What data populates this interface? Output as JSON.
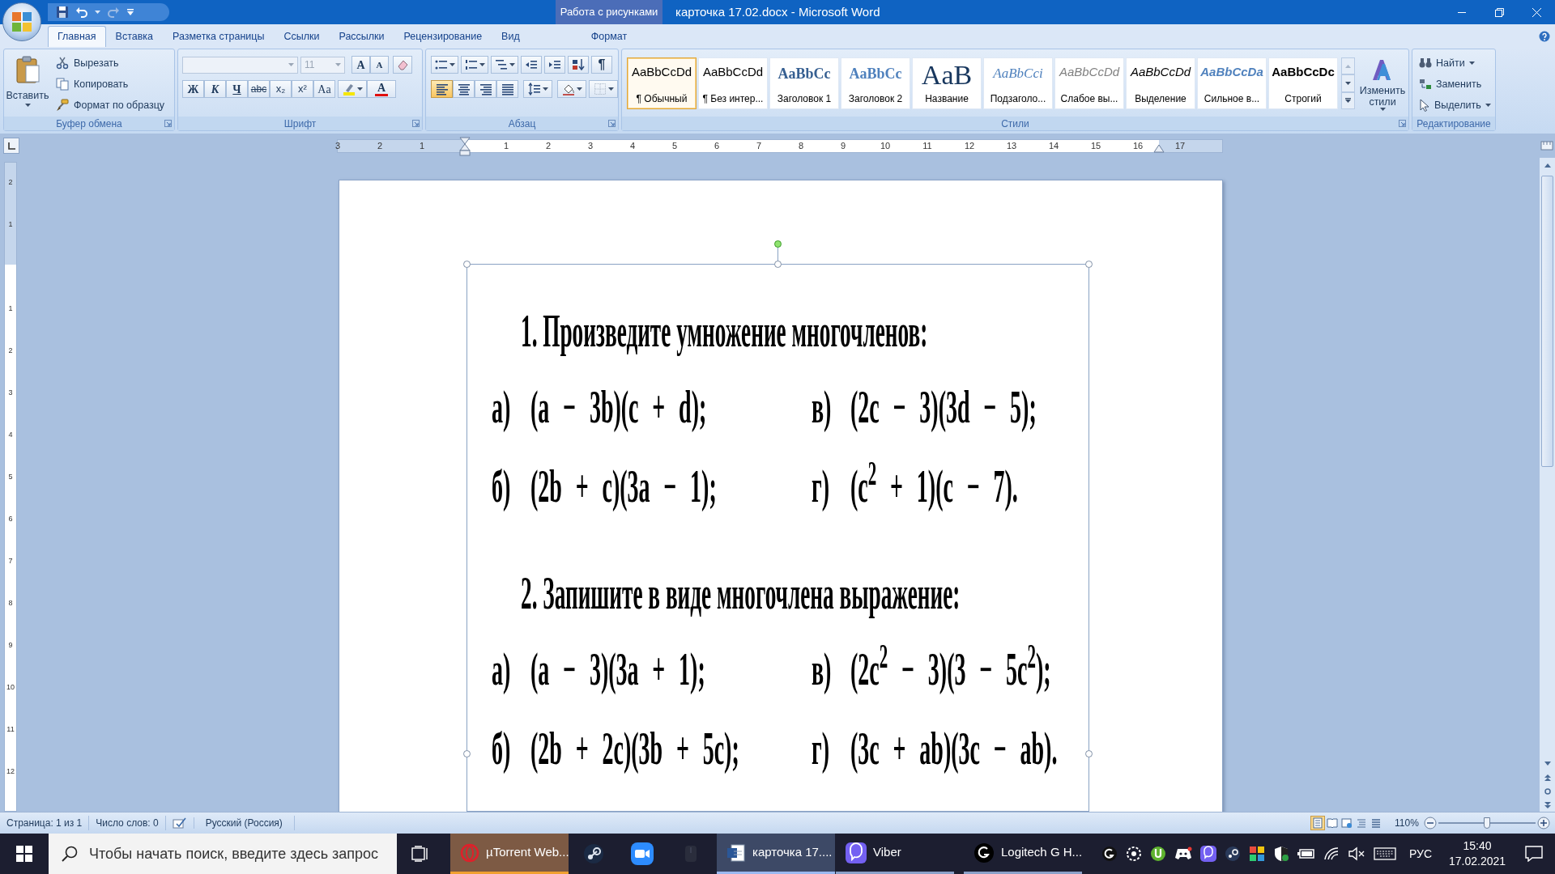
{
  "window": {
    "title": "карточка 17.02.docx - Microsoft Word",
    "contextual_group": "Работа с рисунками"
  },
  "tabs": [
    {
      "label": "Главная",
      "selected": true
    },
    {
      "label": "Вставка",
      "selected": false
    },
    {
      "label": "Разметка страницы",
      "selected": false
    },
    {
      "label": "Ссылки",
      "selected": false
    },
    {
      "label": "Рассылки",
      "selected": false
    },
    {
      "label": "Рецензирование",
      "selected": false
    },
    {
      "label": "Вид",
      "selected": false
    }
  ],
  "contextual_tabs": [
    {
      "label": "Формат",
      "selected": false
    }
  ],
  "clipboard": {
    "label": "Буфер обмена",
    "paste": "Вставить",
    "commands": [
      "Вырезать",
      "Копировать",
      "Формат по образцу"
    ]
  },
  "font": {
    "label": "Шрифт",
    "disabled": true,
    "size": "11",
    "grow_shrink": [
      "A",
      "A"
    ],
    "format_buttons": [
      "Ж",
      "К",
      "Ч",
      "abc",
      "x₂",
      "x²",
      "Aa"
    ],
    "font_color": "A"
  },
  "paragraph": {
    "label": "Абзац",
    "marks_button": "¶",
    "alignment": [
      {
        "selected": true
      },
      {
        "selected": false
      },
      {
        "selected": false
      },
      {
        "selected": false
      }
    ]
  },
  "styles": {
    "label": "Стили",
    "change_styles": "Изменить стили",
    "items": [
      {
        "kind": "normal",
        "sample": "AaBbCcDd",
        "label": "¶ Обычный",
        "selected": true
      },
      {
        "kind": "normal",
        "sample": "AaBbCcDd",
        "label": "¶ Без интер...",
        "selected": false
      },
      {
        "kind": "heading1",
        "sample": "AaBbCc",
        "label": "Заголовок 1",
        "selected": false
      },
      {
        "kind": "heading2",
        "sample": "AaBbCc",
        "label": "Заголовок 2",
        "selected": false
      },
      {
        "kind": "title",
        "sample": "AaB",
        "label": "Название",
        "selected": false
      },
      {
        "kind": "subtitle",
        "sample": "AaBbCci",
        "label": "Подзаголо...",
        "selected": false
      },
      {
        "kind": "subtle",
        "sample": "AaBbCcDd",
        "label": "Слабое вы...",
        "selected": false
      },
      {
        "kind": "emphasis",
        "sample": "AaBbCcDd",
        "label": "Выделение",
        "selected": false
      },
      {
        "kind": "intense",
        "sample": "AaBbCcDa",
        "label": "Сильное в...",
        "selected": false
      },
      {
        "kind": "strong",
        "sample": "AaBbCcDc",
        "label": "Строгий",
        "selected": false
      }
    ]
  },
  "editing": {
    "label": "Редактирование",
    "commands": [
      "Найти",
      "Заменить",
      "Выделить"
    ]
  },
  "ruler": {
    "left_labels": [
      "3",
      "2",
      "1"
    ],
    "labels": [
      "1",
      "2",
      "3",
      "4",
      "5",
      "6",
      "7",
      "8",
      "9",
      "10",
      "11",
      "12",
      "13",
      "14",
      "15",
      "16",
      "17"
    ]
  },
  "vertical_ruler": {
    "top_labels": [
      "2",
      "1"
    ],
    "labels": [
      "1",
      "2",
      "3",
      "4",
      "5",
      "6",
      "7",
      "8",
      "9",
      "10",
      "11",
      "12"
    ]
  },
  "document": {
    "image": {
      "selected": true,
      "sections": [
        {
          "heading": "1. Произведите умножение многочленов:",
          "items": [
            {
              "letter": "а)",
              "expr": "(a − 3b)(c + d);"
            },
            {
              "letter": "в)",
              "expr": "(2c − 3)(3d − 5);"
            },
            {
              "letter": "б)",
              "expr": "(2b + c)(3a − 1);"
            },
            {
              "letter": "г)",
              "expr": "(c$^{2}$ + 1)(c − 7)."
            }
          ]
        },
        {
          "heading": "2. Запишите в виде многочлена выражение:",
          "items": [
            {
              "letter": "а)",
              "expr": "(a − 3)(3a + 1);"
            },
            {
              "letter": "в)",
              "expr": "(2c$^{2}$ − 3)(3 − 5c$^{2}$);"
            },
            {
              "letter": "б)",
              "expr": "(2b + 2c)(3b + 5c);"
            },
            {
              "letter": "г)",
              "expr": "(3c + ab)(3c − ab)."
            }
          ]
        }
      ]
    }
  },
  "status_bar": {
    "page": "Страница: 1 из 1",
    "words": "Число слов: 0",
    "language": "Русский (Россия)",
    "views": [
      {
        "selected": true
      },
      {
        "selected": false
      },
      {
        "selected": false
      },
      {
        "selected": false
      },
      {
        "selected": false
      }
    ],
    "zoom": "110%",
    "zoom_slider": {
      "level": 0.5
    }
  },
  "taskbar": {
    "search_placeholder": "Чтобы начать поиск, введите здесь запрос",
    "apps": [
      {
        "kind": "ring",
        "label": "µTorrent Web...",
        "selected": false,
        "attention": true,
        "running": true
      },
      {
        "kind": "steam",
        "selected": false,
        "attention": false,
        "running": false
      },
      {
        "kind": "camera",
        "selected": false,
        "attention": false,
        "running": false
      },
      {
        "kind": "dark",
        "selected": false,
        "attention": false,
        "running": false
      },
      {
        "kind": "document",
        "label": "карточка 17....",
        "selected": true,
        "attention": false,
        "running": true
      },
      {
        "kind": "chat",
        "label": "Viber",
        "selected": false,
        "attention": false,
        "running": true
      },
      {
        "kind": "g",
        "label": "Logitech G H...",
        "selected": false,
        "attention": false,
        "running": true
      }
    ],
    "language": "РУС",
    "time": "15:40",
    "date": "17.02.2021"
  }
}
